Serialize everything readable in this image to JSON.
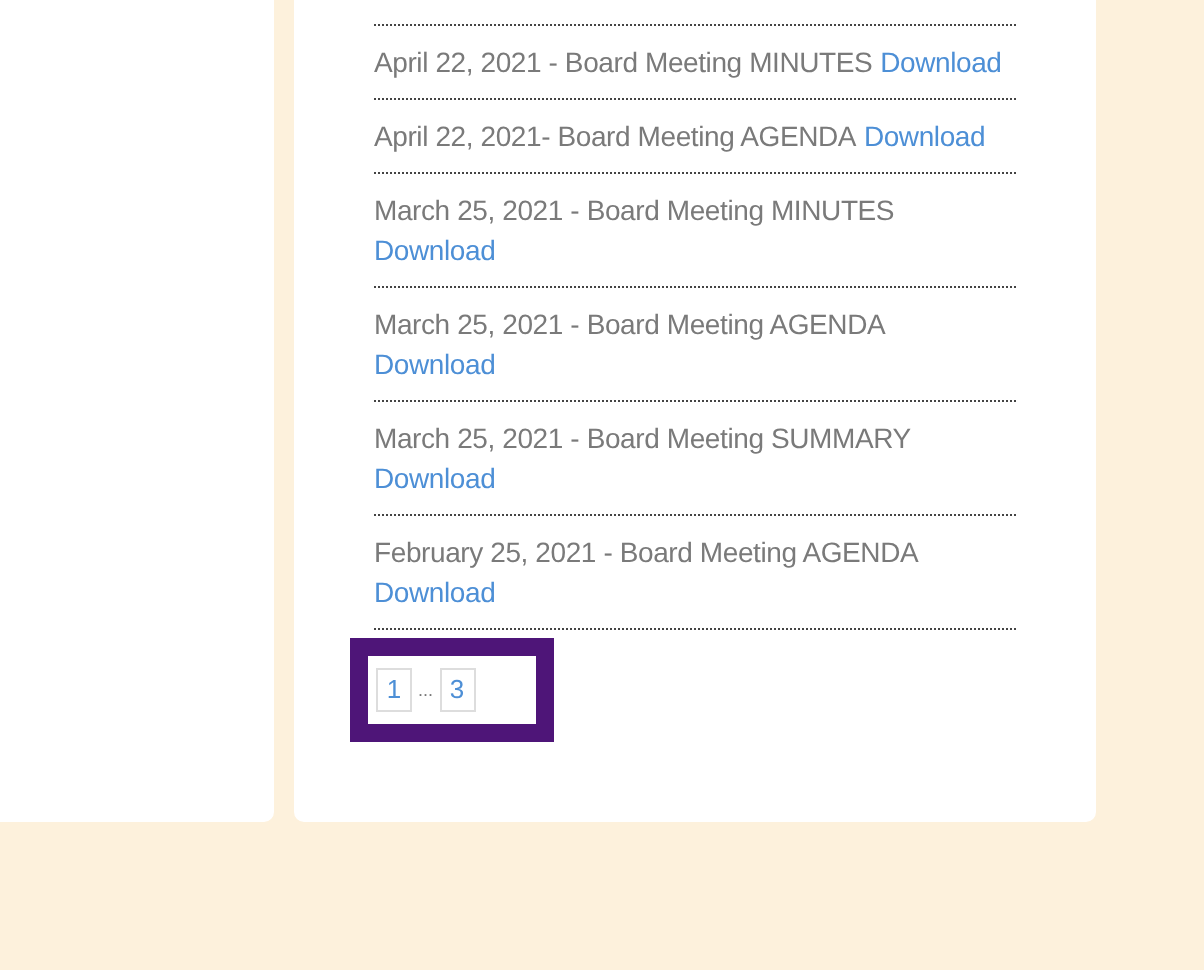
{
  "documents": [
    {
      "title": "April 22, 2021 - Board Meeting MINUTES",
      "link": "Download"
    },
    {
      "title": "April 22, 2021- Board Meeting AGENDA",
      "link": "Download"
    },
    {
      "title": "March 25, 2021 - Board Meeting MINUTES",
      "link": "Download"
    },
    {
      "title": "March 25, 2021 - Board Meeting AGENDA",
      "link": "Download"
    },
    {
      "title": "March 25, 2021 - Board Meeting SUMMARY",
      "link": "Download"
    },
    {
      "title": "February 25, 2021 - Board Meeting AGENDA",
      "link": "Download"
    }
  ],
  "pagination": [
    {
      "kind": "page",
      "label": "1"
    },
    {
      "kind": "ellipsis",
      "label": "..."
    },
    {
      "kind": "page",
      "label": "3"
    }
  ]
}
